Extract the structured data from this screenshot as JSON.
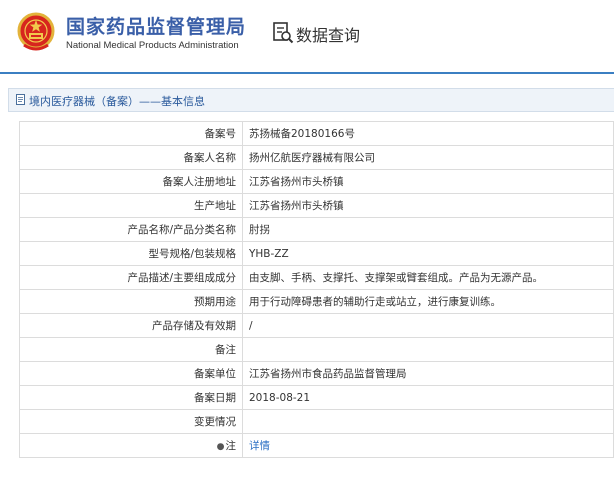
{
  "header": {
    "agency_name_cn": "国家药品监督管理局",
    "agency_name_en": "National Medical Products Administration",
    "emblem_icon": "national-emblem-icon",
    "query_icon": "document-search-icon",
    "query_title": "数据查询"
  },
  "breadcrumb": {
    "icon": "document-icon",
    "text": "境内医疗器械（备案）——基本信息"
  },
  "record": {
    "rows": [
      {
        "label": "备案号",
        "value": "苏扬械备20180166号"
      },
      {
        "label": "备案人名称",
        "value": "扬州亿航医疗器械有限公司"
      },
      {
        "label": "备案人注册地址",
        "value": "江苏省扬州市头桥镇"
      },
      {
        "label": "生产地址",
        "value": "江苏省扬州市头桥镇"
      },
      {
        "label": "产品名称/产品分类名称",
        "value": "肘拐"
      },
      {
        "label": "型号规格/包装规格",
        "value": "YHB-ZZ"
      },
      {
        "label": "产品描述/主要组成成分",
        "value": "由支脚、手柄、支撑托、支撑架或臂套组成。产品为无源产品。"
      },
      {
        "label": "预期用途",
        "value": "用于行动障碍患者的辅助行走或站立，进行康复训练。"
      },
      {
        "label": "产品存储及有效期",
        "value": "/"
      },
      {
        "label": "备注",
        "value": ""
      },
      {
        "label": "备案单位",
        "value": "江苏省扬州市食品药品监督管理局"
      },
      {
        "label": "备案日期",
        "value": "2018-08-21"
      },
      {
        "label": "变更情况",
        "value": ""
      }
    ],
    "note_row": {
      "pin_icon": "pin-icon",
      "label": "注",
      "link_text": "详情"
    }
  },
  "colors": {
    "brand_blue": "#3a5fa8",
    "rule_blue": "#3b7fc2",
    "link_blue": "#2a6fc4",
    "breadcrumb_bg": "#eef3f9"
  }
}
